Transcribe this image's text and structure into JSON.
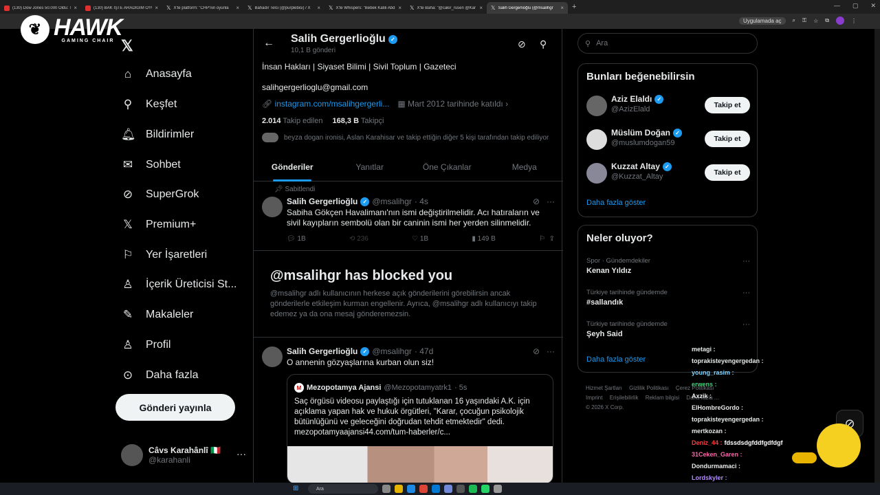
{
  "browser": {
    "tabs": [
      {
        "title": "(130) Dow Jones 50.000 Oldu: T"
      },
      {
        "title": "(130) BAK İŞTE ARADIĞIM OYUN"
      },
      {
        "title": "X'te platform: \"CHP'nin oyunla"
      },
      {
        "title": "Bahadır Telci (@purplebisi) / X"
      },
      {
        "title": "X'te Whispers: \"Bebek Katili Abd"
      },
      {
        "title": "X'te Baha: \"@cakir_rusen @Kar"
      },
      {
        "title": "Salih Gergerlioğlu (@msalihgr"
      }
    ],
    "new_tab": "+",
    "app_pill": "Uygulamada aç"
  },
  "overlay": {
    "brand": "HAWK",
    "brand_sub": "GAMING CHAIR"
  },
  "nav": {
    "items": [
      {
        "label": "Anasayfa",
        "icon": "home-icon"
      },
      {
        "label": "Keşfet",
        "icon": "search-icon"
      },
      {
        "label": "Bildirimler",
        "icon": "bell-icon"
      },
      {
        "label": "Sohbet",
        "icon": "mail-icon"
      },
      {
        "label": "SuperGrok",
        "icon": "grok-icon"
      },
      {
        "label": "Premium+",
        "icon": "x-icon"
      },
      {
        "label": "Yer İşaretleri",
        "icon": "bookmark-icon"
      },
      {
        "label": "İçerik Üreticisi St...",
        "icon": "creator-icon"
      },
      {
        "label": "Makaleler",
        "icon": "articles-icon"
      },
      {
        "label": "Profil",
        "icon": "person-icon"
      },
      {
        "label": "Daha fazla",
        "icon": "more-circle-icon"
      }
    ],
    "post_button": "Gönderi yayınla",
    "account": {
      "name": "Câvs Karahânlî 🇮🇹",
      "handle": "@karahanli"
    }
  },
  "profile": {
    "name": "Salih Gergerlioğlu",
    "post_count": "10,1 B gönderi",
    "bio": "İnsan Hakları | Siyaset Bilimi | Sivil Toplum | Gazeteci",
    "email": "salihgergerlioglu@gmail.com",
    "link": "instagram.com/msalihgergerli...",
    "joined": "Mart 2012 tarihinde katıldı",
    "following_count": "2.014",
    "following_label": "Takip edilen",
    "followers_count": "168,3 B",
    "followers_label": "Takipçi",
    "mutual": "beyza dogan ironisi, Aslan Karahisar ve takip ettiğin diğer 5 kişi tarafından takip ediliyor"
  },
  "tabs": [
    "Gönderiler",
    "Yanıtlar",
    "Öne Çıkanlar",
    "Medya"
  ],
  "tweets": [
    {
      "pinned_label": "Sabitlendi",
      "name": "Salih Gergerlioğlu",
      "handle": "@msalihgr",
      "time": "· 4s",
      "text": "Sabiha Gökçen Havalimanı'nın ismi değiştirilmelidir. Acı hatıraların ve sivil kayıpların sembolü olan bir caninin ismi her yerden silinmelidir.",
      "replies": "1B",
      "retweets": "236",
      "likes": "1B",
      "views": "149 B"
    },
    {
      "name": "Salih Gergerlioğlu",
      "handle": "@msalihgr",
      "time": "· 47d",
      "text": "O annenin gözyaşlarına kurban olun siz!"
    }
  ],
  "blocked": {
    "title": "@msalihgr has blocked you",
    "text": "@msalihgr adlı kullanıcının herkese açık gönderilerini görebilirsin ancak gönderilerle etkileşim kurman engellenir. Ayrıca, @msalihgr adlı kullanıcıyı takip edemez ya da ona mesaj gönderemezsin."
  },
  "quote": {
    "name": "Mezopotamya Ajansi",
    "handle": "@Mezopotamyatrk1",
    "time": "· 5s",
    "text": "Saç örgüsü videosu paylaştığı için tutuklanan 16 yaşındaki A.K. için açıklama yapan hak ve hukuk örgütleri, \"Karar, çocuğun psikolojik bütünlüğünü ve geleceğini doğrudan tehdit etmektedir\" dedi. mezopotamyaajansi44.com/tum-haberler/c..."
  },
  "right": {
    "search_placeholder": "Ara",
    "suggest_title": "Bunları beğenebilirsin",
    "suggestions": [
      {
        "name": "Aziz Elaldı",
        "handle": "@AzizElald",
        "button": "Takip et"
      },
      {
        "name": "Müslüm Doğan",
        "handle": "@muslumdogan59",
        "button": "Takip et"
      },
      {
        "name": "Kuzzat Altay",
        "handle": "@Kuzzat_Altay",
        "button": "Takip et"
      }
    ],
    "show_more": "Daha fazla göster",
    "trends_title": "Neler oluyor?",
    "trends": [
      {
        "context": "Spor · Gündemdekiler",
        "name": "Kenan Yıldız"
      },
      {
        "context": "Türkiye tarihinde gündemde",
        "name": "#sallandık"
      },
      {
        "context": "Türkiye tarihinde gündemde",
        "name": "Şeyh Said"
      }
    ],
    "footer": [
      "Hizmet Şartları",
      "Gizlilik Politikası",
      "Çerez Politikası",
      "Imprint",
      "Erişilebilirlik",
      "Reklam bilgisi",
      "Daha fazla ...",
      "© 2026 X Corp."
    ]
  },
  "chat": [
    {
      "user": "metagi :",
      "color": "#ffffff"
    },
    {
      "user": "toprakisteyengergedan :",
      "color": "#ffffff"
    },
    {
      "user": "young_rasim :",
      "color": "#7fd3ff"
    },
    {
      "user": "erwens :",
      "color": "#3fd17a"
    },
    {
      "user": "Axzik :",
      "color": "#ffffff"
    },
    {
      "user": "ElHombreGordo :",
      "color": "#ffffff"
    },
    {
      "user": "toprakisteyengergedan :",
      "color": "#ffffff"
    },
    {
      "user": "mertkozan :",
      "color": "#ffffff"
    },
    {
      "user": "Deniz_44 :",
      "color": "#ff3b3b",
      "msg": "fdssdsdgfddfgdfdgf"
    },
    {
      "user": "31Ceken_Garen :",
      "color": "#ff66aa"
    },
    {
      "user": "Dondurmamaci :",
      "color": "#ffffff"
    },
    {
      "user": "Lordskyler :",
      "color": "#b38cff"
    }
  ],
  "taskbar": {
    "search": "Ara"
  }
}
